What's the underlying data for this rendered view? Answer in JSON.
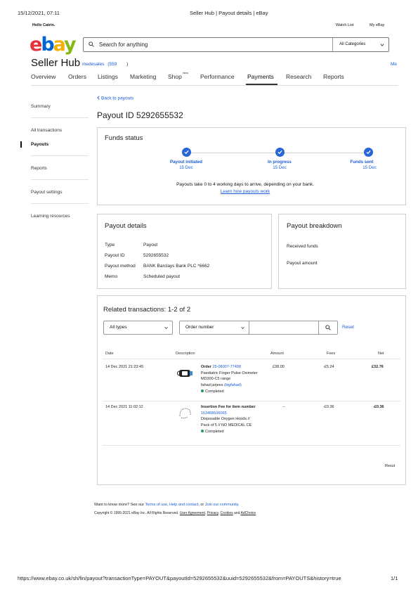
{
  "print_header": {
    "datetime": "15/12/2021, 07:11",
    "title": "Seller Hub | Payout details | eBay"
  },
  "topbar": {
    "greeting": "Hello Catrin.",
    "watchlist": "Watch List",
    "my_ebay": "My eBay"
  },
  "brand": {
    "logo_letters": [
      "e",
      "b",
      "a",
      "y"
    ],
    "colors": [
      "#e53238",
      "#0064d2",
      "#f5af02",
      "#86b817"
    ]
  },
  "search": {
    "placeholder": "Search for anything",
    "category": "All Categories"
  },
  "seller_hub": {
    "title": "Seller Hub",
    "username": "medesales",
    "rating": "(559",
    "rating_close": ")",
    "right_link": "Me"
  },
  "nav": {
    "items": [
      "Overview",
      "Orders",
      "Listings",
      "Marketing",
      "Shop",
      "Performance",
      "Payments",
      "Research",
      "Reports"
    ],
    "shop_badge": "New",
    "active": "Payments"
  },
  "sidebar": {
    "summary": "Summary",
    "all_transactions": "All transactions",
    "payouts": "Payouts",
    "reports": "Reports",
    "payout_settings": "Payout settings",
    "learning": "Learning resources"
  },
  "back_link": "Back to payouts",
  "page_title": "Payout ID 5292655532",
  "funds_status": {
    "title": "Funds status",
    "steps": [
      {
        "label": "Payout initiated",
        "date": "15 Dec"
      },
      {
        "label": "In progress",
        "date": "15 Dec"
      },
      {
        "label": "Funds sent",
        "date": "15 Dec"
      }
    ],
    "note": "Payouts take 0 to 4 working days to arrive, depending on your bank.",
    "learn_link": "Learn how payouts work"
  },
  "payout_details": {
    "title": "Payout details",
    "rows": [
      {
        "k": "Type",
        "v": "Payout"
      },
      {
        "k": "Payout ID",
        "v": "5292655532"
      },
      {
        "k": "Payout method",
        "v": "BANK Barclays Bank PLC *6662"
      },
      {
        "k": "Memo",
        "v": "Scheduled payout"
      }
    ]
  },
  "payout_breakdown": {
    "title": "Payout breakdown",
    "received_funds": "Received funds",
    "payout_amount": "Payout amount"
  },
  "related": {
    "title": "Related transactions: 1-2 of 2",
    "type_select": "All types",
    "field_select": "Order number",
    "reset": "Reset",
    "columns": {
      "date": "Date",
      "description": "Description",
      "amount": "Amount",
      "fees": "Fees",
      "net": "Net"
    },
    "rows": [
      {
        "date": "14 Dec 2021 21:23:45",
        "desc_prefix": "Order",
        "link": "25-08007-77498",
        "desc": "Paediatric Finger Pulse Oximeter MD300-C5 range",
        "buyer": "fahad jarjees",
        "buyer_handle": "(bigfahad)",
        "status": "Completed",
        "amount": "£38.00",
        "fees": "-£5.24",
        "net": "£32.76"
      },
      {
        "date": "14 Dec 2021 11:02:12",
        "desc_prefix": "Insertion Fee for item number",
        "link": "153468536065",
        "desc": "Disposable Oxygen Hoods // Pack of 5 // NO MEDICAL CE",
        "status": "Completed",
        "amount": "--",
        "fees": "-£0.36",
        "net": "-£0.36"
      }
    ],
    "results_partial": "Resul"
  },
  "footer": {
    "want_more": "Want to know more? See our",
    "terms": "Terms of use",
    "comma": ",",
    "help": "Help and contact",
    "or": ", or",
    "join": "Join our community",
    "period": ".",
    "copyright": "Copyright © 1995-2021 eBay Inc. All Rights Reserved.",
    "user_agreement": "User Agreement",
    "privacy": "Privacy",
    "cookies": "Cookies",
    "and": "and",
    "adchoice": "AdChoice"
  },
  "print_footer": {
    "url": "https://www.ebay.co.uk/sh/fin/payout?transactionType=PAYOUT&payoutId=5292655532&uuid=5292655532&from=PAYOUTS&history=true",
    "page": "1/1"
  }
}
